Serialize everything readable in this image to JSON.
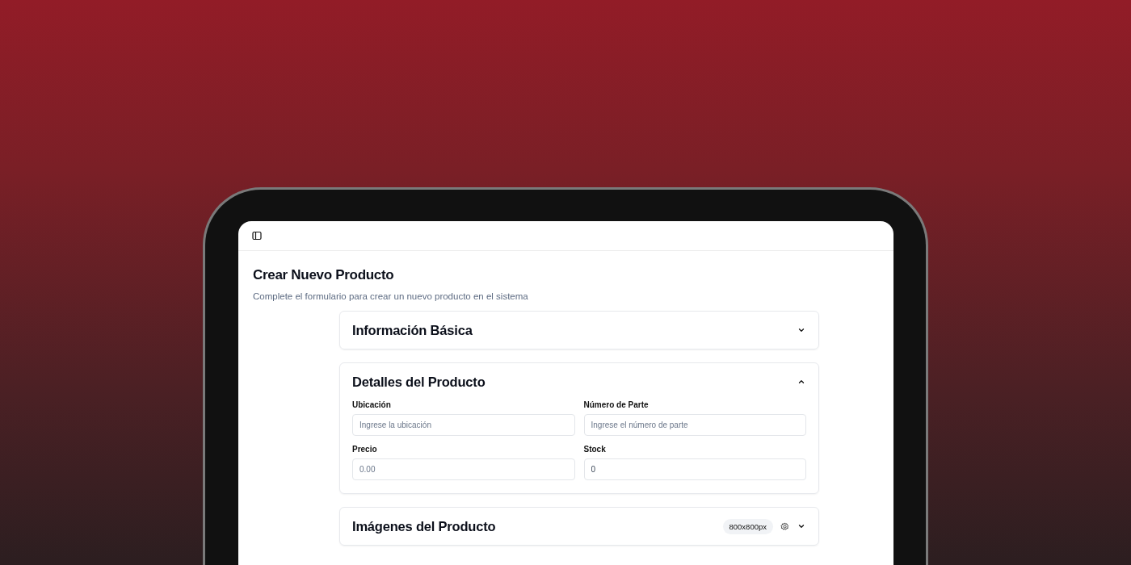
{
  "page": {
    "title": "Crear Nuevo Producto",
    "subtitle": "Complete el formulario para crear un nuevo producto en el sistema"
  },
  "sections": [
    {
      "title": "Información Básica",
      "expanded": false
    },
    {
      "title": "Detalles del Producto",
      "expanded": true,
      "fields": [
        {
          "label": "Ubicación",
          "placeholder": "Ingrese la ubicación"
        },
        {
          "label": "Número de Parte",
          "placeholder": "Ingrese el número de parte"
        },
        {
          "label": "Precio",
          "placeholder": "0.00"
        },
        {
          "label": "Stock",
          "value": "0"
        }
      ]
    },
    {
      "title": "Imágenes del Producto",
      "expanded": false,
      "badge": "800x800px",
      "settings": true
    }
  ]
}
